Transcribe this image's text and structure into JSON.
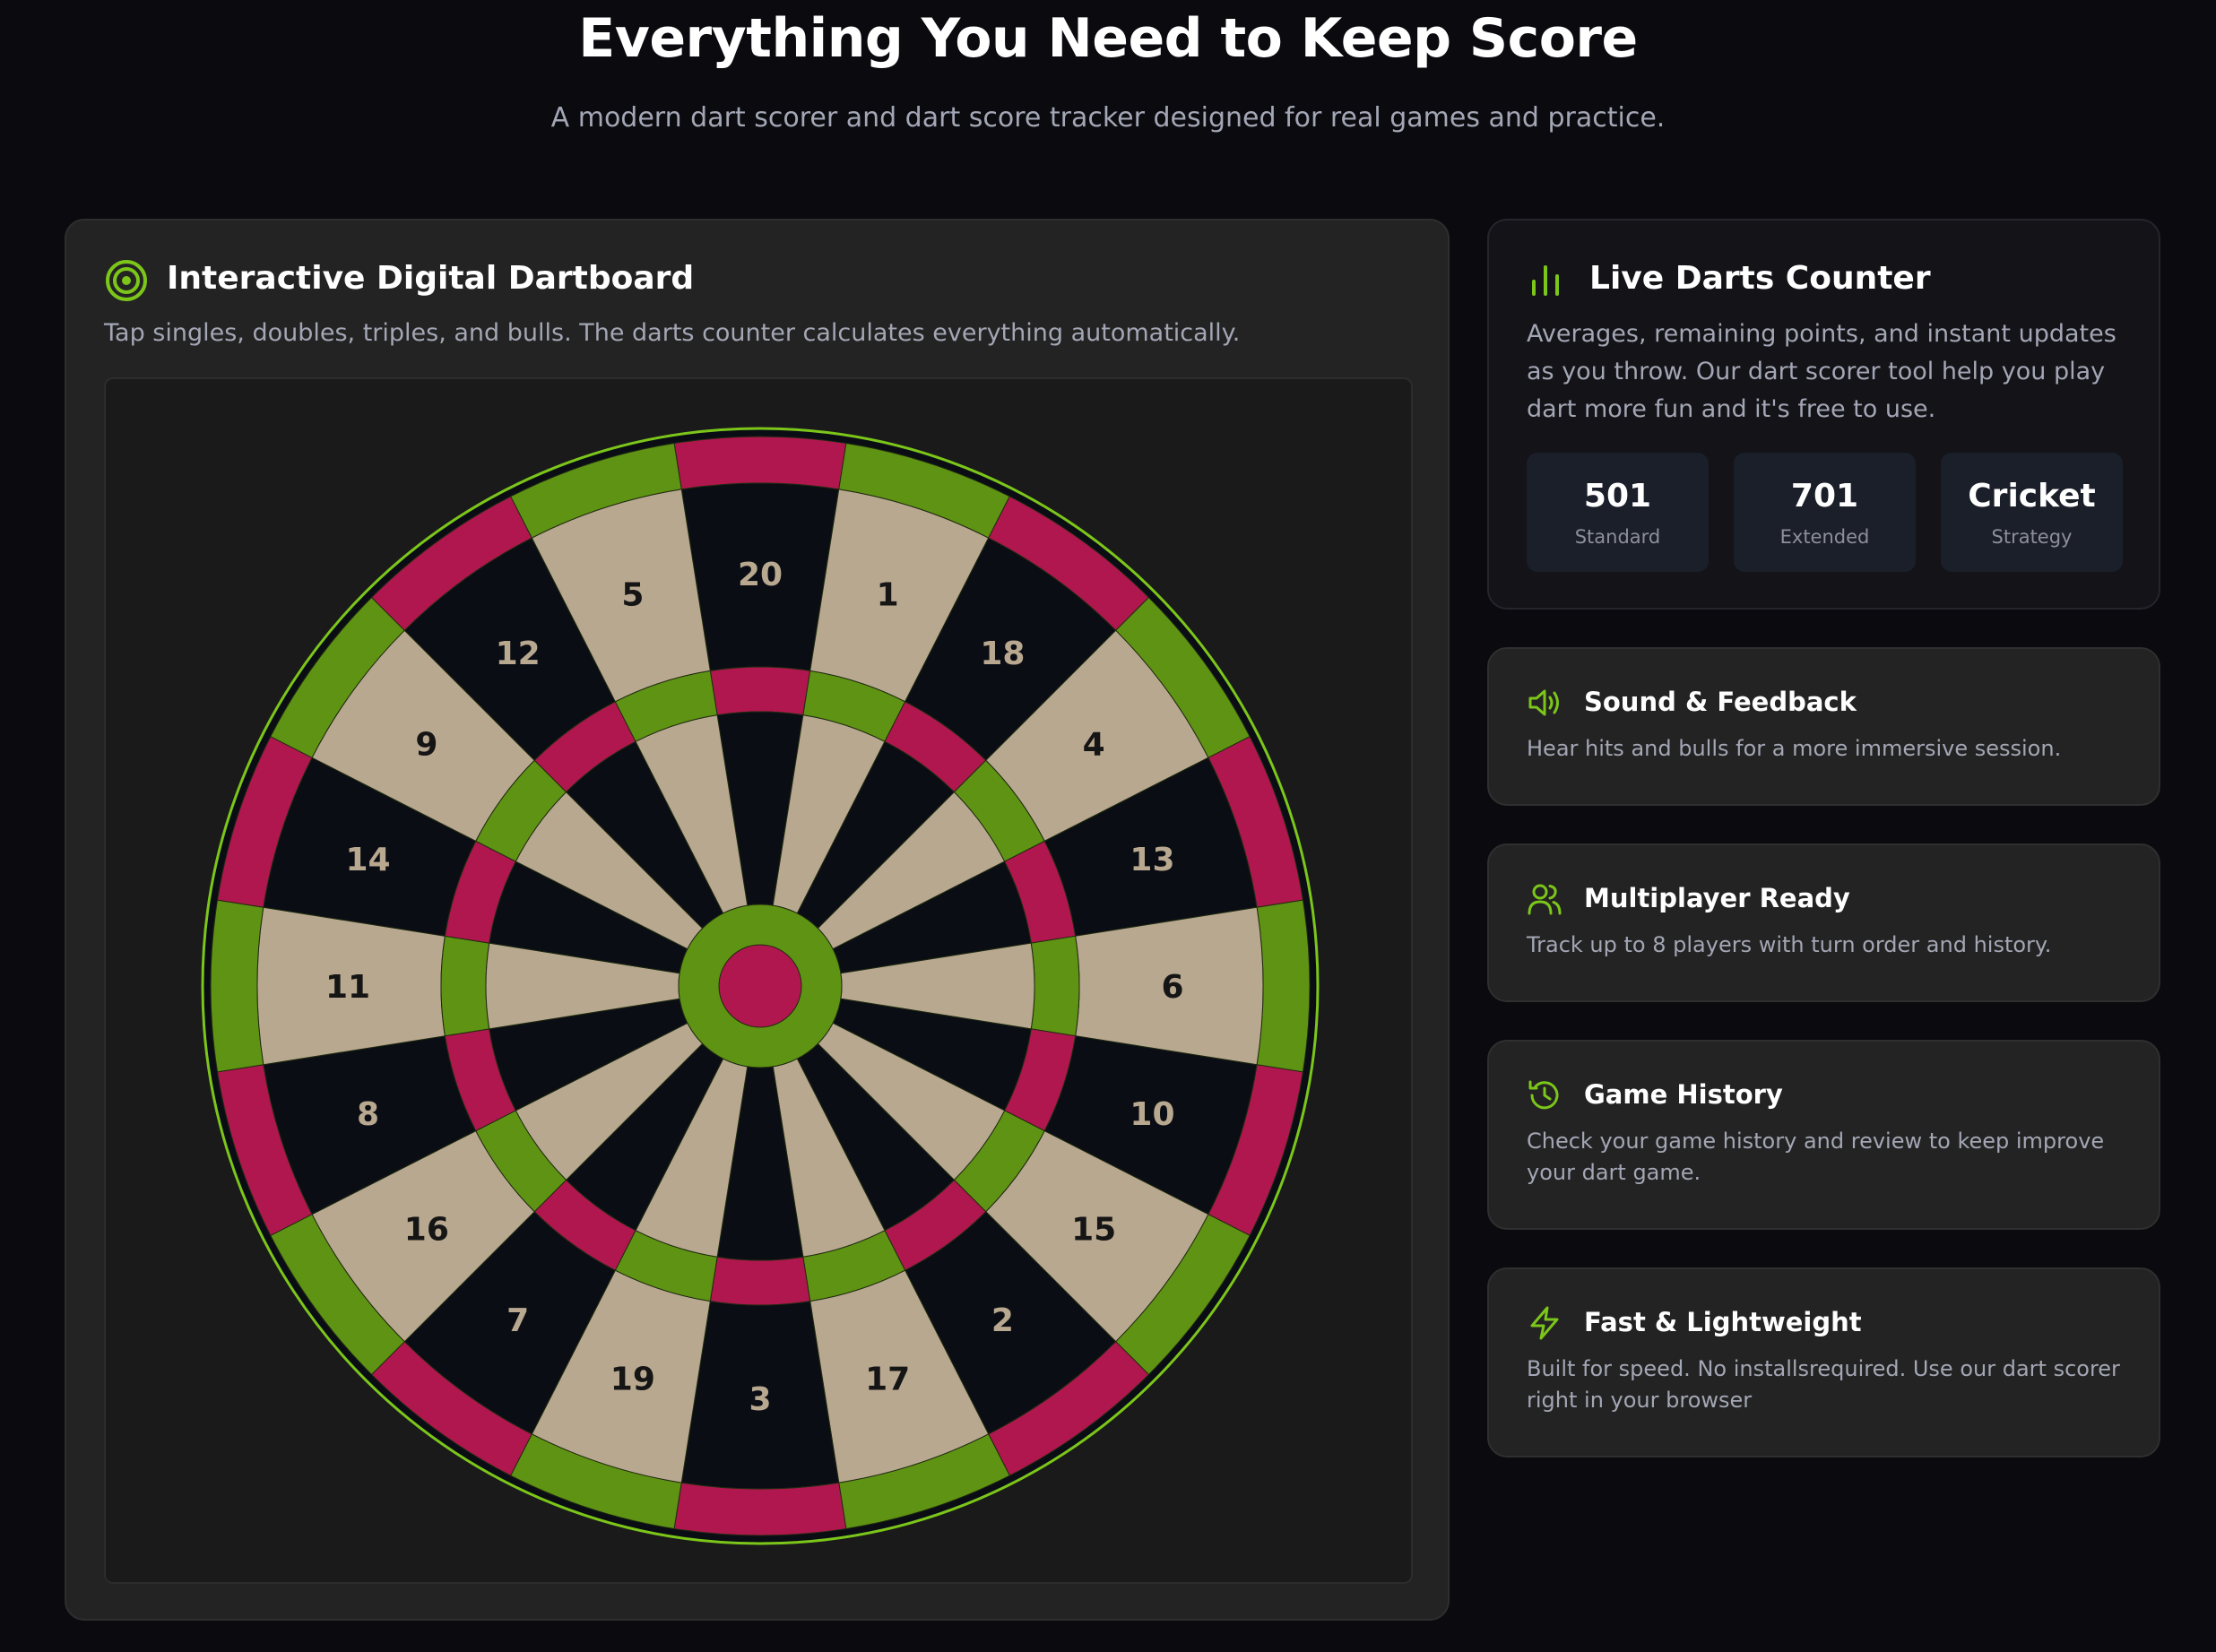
{
  "hero": {
    "title": "Everything You Need to Keep Score",
    "subtitle": "A modern dart scorer and dart score tracker designed for real games and practice."
  },
  "board_card": {
    "icon": "target-icon",
    "title": "Interactive Digital Dartboard",
    "description": "Tap singles, doubles, triples, and bulls. The darts counter calculates everything automatically.",
    "numbers": [
      "20",
      "1",
      "18",
      "4",
      "13",
      "6",
      "10",
      "15",
      "2",
      "17",
      "3",
      "19",
      "7",
      "16",
      "8",
      "11",
      "14",
      "9",
      "12",
      "5"
    ],
    "colors": {
      "dark_segment": "#0b0d15",
      "light_segment": "#b8a88f",
      "red_ring": "#b0174e",
      "green_ring": "#5f9313",
      "outer_border": "#0b0d15",
      "accent": "#7cc61a"
    }
  },
  "counter_card": {
    "icon": "bar-chart-icon",
    "title": "Live Darts Counter",
    "description": "Averages, remaining points, and instant updates as you throw. Our dart scorer tool help you play dart more fun and it's free to use.",
    "modes": [
      {
        "value": "501",
        "label": "Standard"
      },
      {
        "value": "701",
        "label": "Extended"
      },
      {
        "value": "Cricket",
        "label": "Strategy"
      }
    ]
  },
  "features": [
    {
      "icon": "speaker-icon",
      "title": "Sound & Feedback",
      "description": "Hear hits and bulls for a more immersive session."
    },
    {
      "icon": "users-icon",
      "title": "Multiplayer Ready",
      "description": "Track up to 8 players with turn order and history."
    },
    {
      "icon": "history-icon",
      "title": "Game History",
      "description": "Check your game history and review to keep improve your dart game."
    },
    {
      "icon": "lightning-icon",
      "title": "Fast & Lightweight",
      "description": "Built for speed. No installsrequired. Use our dart scorer right in your browser"
    }
  ]
}
